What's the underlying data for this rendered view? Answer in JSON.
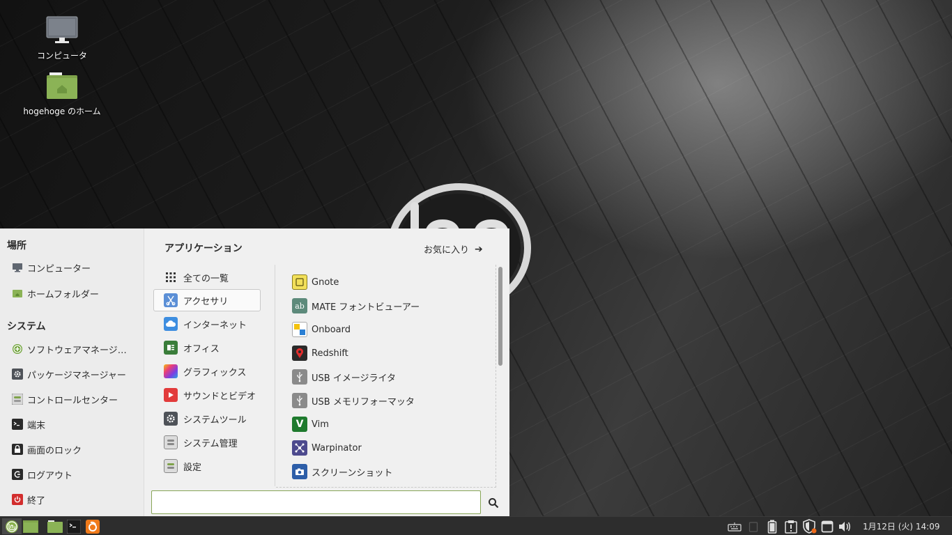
{
  "desktop": {
    "icons": [
      {
        "label": "コンピュータ",
        "icon": "monitor-icon"
      },
      {
        "label": "hogehoge のホーム",
        "icon": "home-folder-icon"
      }
    ]
  },
  "menu": {
    "places": {
      "heading": "場所",
      "items": [
        {
          "label": "コンピューター",
          "icon": "monitor-icon"
        },
        {
          "label": "ホームフォルダー",
          "icon": "home-folder-icon"
        }
      ]
    },
    "system": {
      "heading": "システム",
      "items": [
        {
          "label": "ソフトウェアマネージ…",
          "icon": "software-manager-icon"
        },
        {
          "label": "パッケージマネージャー",
          "icon": "gear-icon"
        },
        {
          "label": "コントロールセンター",
          "icon": "control-center-icon"
        },
        {
          "label": "端末",
          "icon": "terminal-icon"
        },
        {
          "label": "画面のロック",
          "icon": "lock-icon"
        },
        {
          "label": "ログアウト",
          "icon": "logout-icon"
        },
        {
          "label": "終了",
          "icon": "power-icon"
        }
      ]
    },
    "applications_heading": "アプリケーション",
    "favorites_label": "お気に入り",
    "categories": [
      {
        "label": "全ての一覧",
        "icon": "grid-icon"
      },
      {
        "label": "アクセサリ",
        "icon": "scissors-icon",
        "selected": true
      },
      {
        "label": "インターネット",
        "icon": "cloud-icon"
      },
      {
        "label": "オフィス",
        "icon": "office-icon"
      },
      {
        "label": "グラフィックス",
        "icon": "graphics-icon"
      },
      {
        "label": "サウンドとビデオ",
        "icon": "play-icon"
      },
      {
        "label": "システムツール",
        "icon": "gear-icon"
      },
      {
        "label": "システム管理",
        "icon": "toggle-icon"
      },
      {
        "label": "設定",
        "icon": "settings-toggle-icon"
      }
    ],
    "apps": [
      {
        "label": "Gnote",
        "icon": "note-icon"
      },
      {
        "label": "MATE フォントビューアー",
        "icon": "font-icon"
      },
      {
        "label": "Onboard",
        "icon": "keyboard-icon"
      },
      {
        "label": "Redshift",
        "icon": "redshift-icon"
      },
      {
        "label": "USB イメージライタ",
        "icon": "usb-icon"
      },
      {
        "label": "USB メモリフォーマッタ",
        "icon": "usb-icon"
      },
      {
        "label": "Vim",
        "icon": "vim-icon"
      },
      {
        "label": "Warpinator",
        "icon": "warpinator-icon"
      },
      {
        "label": "スクリーンショット",
        "icon": "camera-icon"
      }
    ],
    "search": {
      "value": "",
      "placeholder": ""
    }
  },
  "panel": {
    "launchers": [
      "mint-menu-icon",
      "show-desktop-icon",
      "file-manager-icon",
      "terminal-icon",
      "firefox-icon"
    ],
    "tray": [
      "keyboard-icon",
      "clipboard-icon",
      "battery-icon",
      "update-icon",
      "shield-icon",
      "window-icon",
      "volume-icon"
    ],
    "clock": "1月12日 (火) 14:09"
  },
  "colors": {
    "accent": "#8ab14c",
    "panel": "#2d2d2d",
    "menu_bg": "#f0f0f0"
  }
}
